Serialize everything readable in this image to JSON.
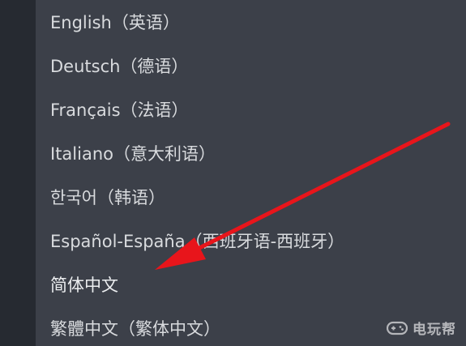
{
  "language_menu": {
    "items": [
      {
        "label": "English（英语）"
      },
      {
        "label": "Deutsch（德语）"
      },
      {
        "label": "Français（法语）"
      },
      {
        "label": "Italiano（意大利语）"
      },
      {
        "label": "한국어（韩语）"
      },
      {
        "label": "Español-España（西班牙语-西班牙）"
      },
      {
        "label": "简体中文"
      },
      {
        "label": "繁體中文（繁体中文）"
      }
    ],
    "highlighted_index": 6
  },
  "annotation": {
    "icon": "red-arrow-icon",
    "color": "#e8151b"
  },
  "watermark": {
    "text": "电玩帮",
    "icon": "game-controller-icon"
  },
  "colors": {
    "menu_background": "#3c4049",
    "left_strip": "#262a31",
    "menu_text": "#d9dbde"
  }
}
